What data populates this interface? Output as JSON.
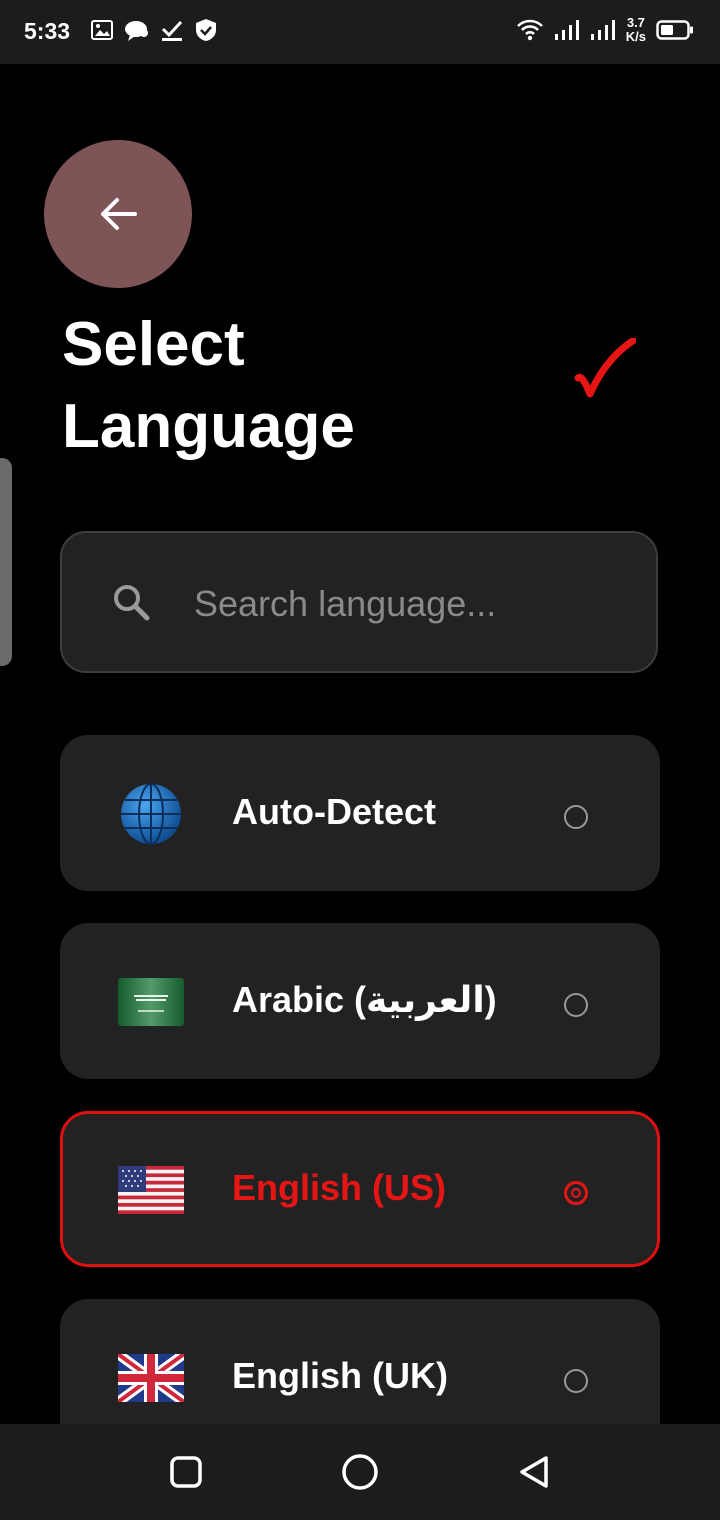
{
  "status_bar": {
    "time": "5:33",
    "speed_value": "3.7",
    "speed_unit": "K/s",
    "left_icons": [
      "image-icon",
      "chat-icon",
      "download-check-icon",
      "shield-icon"
    ],
    "right_icons": [
      "wifi-icon",
      "signal-icon",
      "signal-icon",
      "battery-icon"
    ]
  },
  "header": {
    "title_line1": "Select",
    "title_line2": "Language",
    "back_icon": "arrow-left-icon",
    "confirm_icon": "checkmark-icon"
  },
  "search": {
    "placeholder": "Search language...",
    "value": ""
  },
  "languages": [
    {
      "label": "Auto-Detect",
      "icon": "globe-icon",
      "selected": false
    },
    {
      "label": "Arabic (العربية)",
      "icon": "saudi-flag-icon",
      "selected": false
    },
    {
      "label": "English (US)",
      "icon": "us-flag-icon",
      "selected": true
    },
    {
      "label": "English (UK)",
      "icon": "uk-flag-icon",
      "selected": false
    }
  ],
  "colors": {
    "accent": "#e81515",
    "back_button": "#7e5457",
    "card": "#222222",
    "background": "#000000"
  },
  "nav_bar": {
    "buttons": [
      "recents-square-icon",
      "home-circle-icon",
      "back-triangle-icon"
    ]
  }
}
